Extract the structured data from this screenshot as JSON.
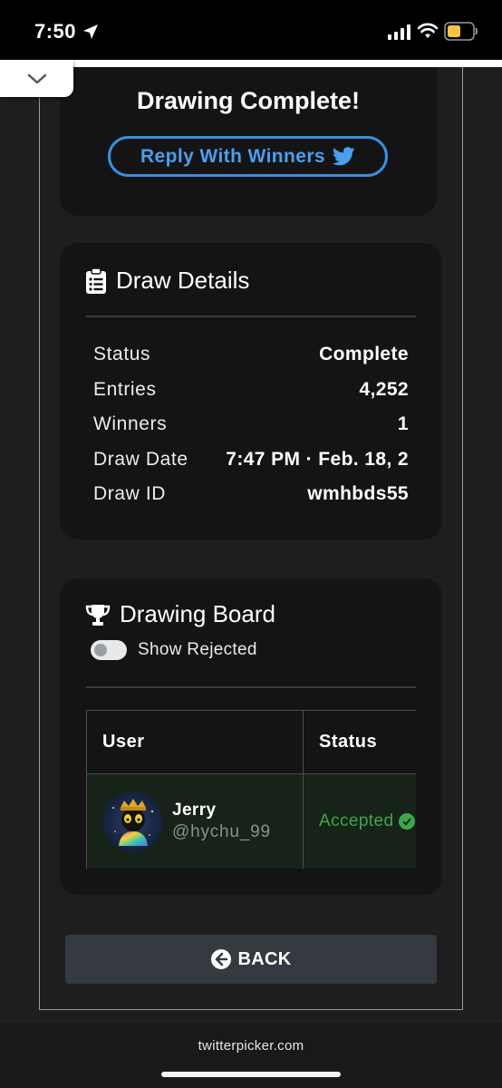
{
  "status_bar": {
    "time": "7:50",
    "battery_color": "#f5c542"
  },
  "complete_card": {
    "title": "Drawing Complete!",
    "reply_button": "Reply With Winners"
  },
  "details": {
    "header": "Draw Details",
    "rows": [
      {
        "key": "Status",
        "value": "Complete"
      },
      {
        "key": "Entries",
        "value": "4,252"
      },
      {
        "key": "Winners",
        "value": "1"
      },
      {
        "key": "Draw Date",
        "value": "7:47 PM · Feb. 18, 2"
      },
      {
        "key": "Draw ID",
        "value": "wmhbds55"
      }
    ]
  },
  "board": {
    "header": "Drawing Board",
    "toggle_label": "Show Rejected",
    "toggle_on": false,
    "columns": [
      "User",
      "Status"
    ],
    "rows": [
      {
        "name": "Jerry",
        "handle": "@hychu_99",
        "status": "Accepted"
      }
    ]
  },
  "back_button": "BACK",
  "browser": {
    "domain": "twitterpicker.com"
  },
  "colors": {
    "accent_blue": "#3a8fe0",
    "accepted_green": "#3fa64a",
    "card_bg": "#141414",
    "page_bg": "#1e1e1f"
  }
}
